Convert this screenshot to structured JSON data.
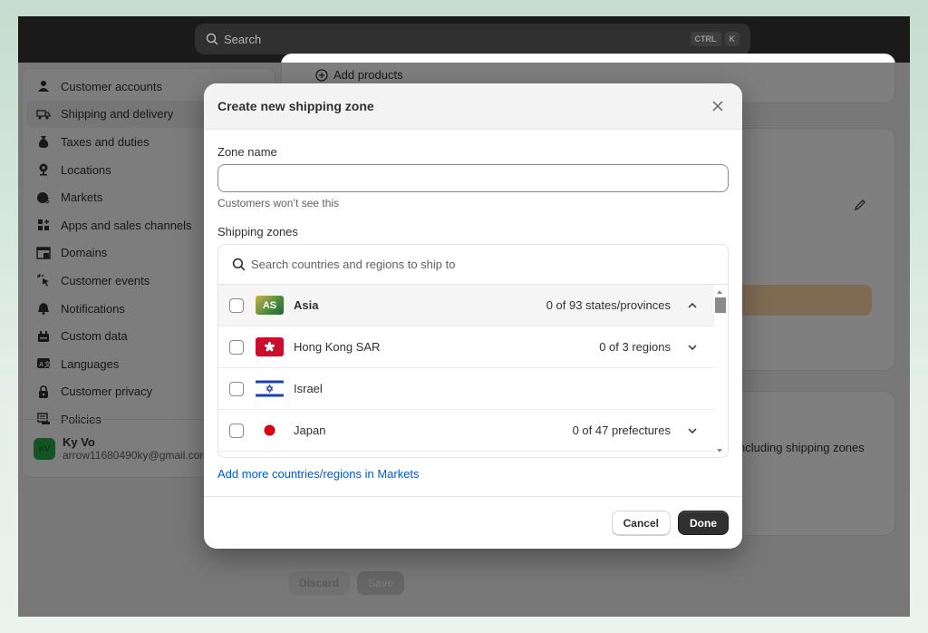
{
  "topbar": {
    "search_placeholder": "Search",
    "shortcut_keys": [
      "CTRL",
      "K"
    ]
  },
  "sidebar": {
    "items": [
      {
        "label": "Customer accounts",
        "icon": "person-icon"
      },
      {
        "label": "Shipping and delivery",
        "icon": "truck-icon",
        "active": true
      },
      {
        "label": "Taxes and duties",
        "icon": "money-bag-icon"
      },
      {
        "label": "Locations",
        "icon": "location-pin-icon"
      },
      {
        "label": "Markets",
        "icon": "globe-dollar-icon"
      },
      {
        "label": "Apps and sales channels",
        "icon": "apps-grid-icon"
      },
      {
        "label": "Domains",
        "icon": "domain-icon"
      },
      {
        "label": "Customer events",
        "icon": "cursor-click-icon"
      },
      {
        "label": "Notifications",
        "icon": "bell-icon"
      },
      {
        "label": "Custom data",
        "icon": "custom-data-icon"
      },
      {
        "label": "Languages",
        "icon": "language-icon"
      },
      {
        "label": "Customer privacy",
        "icon": "lock-icon"
      },
      {
        "label": "Policies",
        "icon": "policy-icon"
      }
    ],
    "user": {
      "initials": "KV",
      "name": "Ky Vo",
      "email": "arrow11680490ky@gmail.com"
    }
  },
  "background": {
    "add_products_label": "Add products",
    "shipping_zones_text": "ncluding shipping zones",
    "discard_label": "Discard",
    "save_label": "Save"
  },
  "modal": {
    "title": "Create new shipping zone",
    "zone_name_label": "Zone name",
    "zone_name_value": "",
    "zone_name_help": "Customers won’t see this",
    "shipping_zones_label": "Shipping zones",
    "search_placeholder": "Search countries and regions to ship to",
    "rows": [
      {
        "name": "Asia",
        "flag": "AS",
        "count": "0 of 93 states/provinces",
        "expanded": true,
        "group": true,
        "checked": false
      },
      {
        "name": "Hong Kong SAR",
        "flag": "hk-flag",
        "count": "0 of 3 regions",
        "expanded": false,
        "checked": false
      },
      {
        "name": "Israel",
        "flag": "il-flag",
        "count": "",
        "checked": false
      },
      {
        "name": "Japan",
        "flag": "jp-flag",
        "count": "0 of 47 prefectures",
        "expanded": false,
        "checked": false
      }
    ],
    "add_more_link": "Add more countries/regions in Markets",
    "cancel_label": "Cancel",
    "done_label": "Done"
  }
}
